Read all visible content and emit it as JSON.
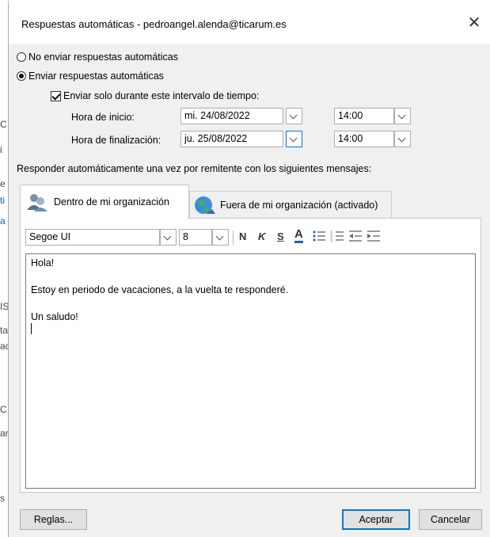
{
  "background_fragments": [
    "C",
    "i",
    "e",
    "ti",
    "a",
    "IS",
    "ta",
    "ac",
    "C",
    "ar",
    "s"
  ],
  "dialog": {
    "title": "Respuestas automáticas - pedroangel.alenda@ticarum.es",
    "close_glyph": "✕"
  },
  "options": {
    "no_send_label": "No enviar respuestas automáticas",
    "no_send_selected": false,
    "send_label": "Enviar respuestas automáticas",
    "send_selected": true,
    "interval_label": "Enviar solo durante este intervalo de tiempo:",
    "interval_checked": true
  },
  "schedule": {
    "start_label": "Hora de inicio:",
    "start_date": "mi. 24/08/2022",
    "start_time": "14:00",
    "end_label": "Hora de finalización:",
    "end_date": "ju. 25/08/2022",
    "end_time": "14:00"
  },
  "respond_label": "Responder automáticamente una vez por remitente con los siguientes mensajes:",
  "tabs": [
    {
      "label": "Dentro de mi organización",
      "active": true
    },
    {
      "label": "Fuera de mi organización (activado)",
      "active": false
    }
  ],
  "toolbar": {
    "font": "Segoe UI",
    "size": "8",
    "bold": "N",
    "italic": "K",
    "underline": "S",
    "font_color": "A"
  },
  "message": {
    "line1": "Hola!",
    "line2": "Estoy en periodo de vacaciones, a la vuelta te responderé.",
    "line3": "Un saludo!"
  },
  "buttons": {
    "rules": "Reglas...",
    "accept": "Aceptar",
    "cancel": "Cancelar"
  },
  "colors": {
    "accent": "#0078d7",
    "font_color_bar": "#1f5fbf"
  }
}
